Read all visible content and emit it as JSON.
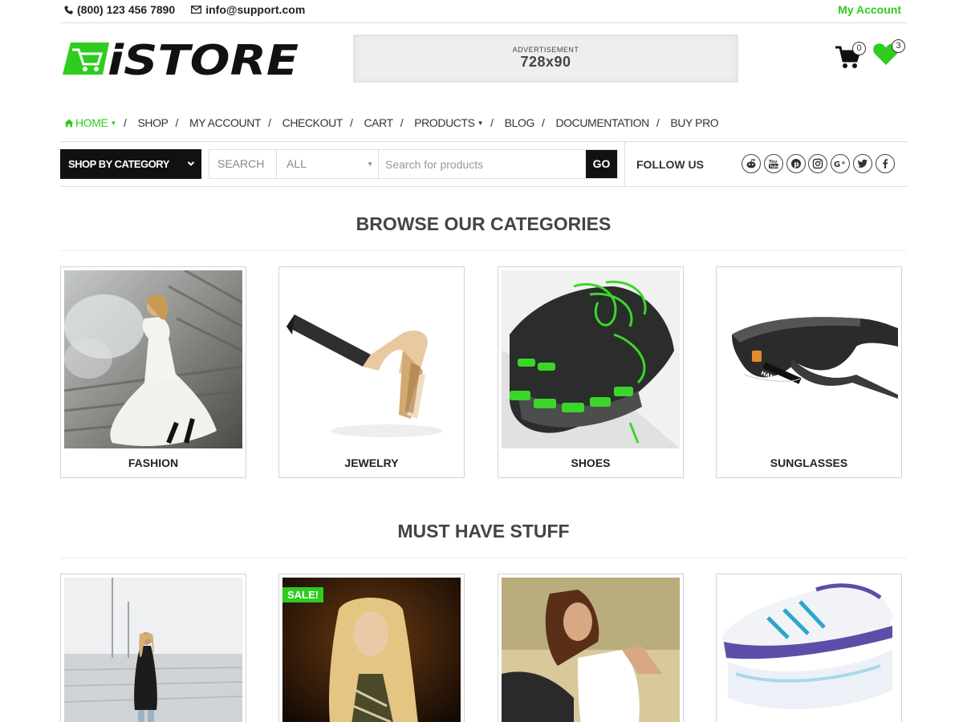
{
  "topbar": {
    "phone": "(800) 123 456 7890",
    "email": "info@support.com",
    "account_link": "My Account"
  },
  "header": {
    "logo_text": "iSTORE",
    "ad": {
      "label": "ADVERTISEMENT",
      "size": "728x90"
    },
    "cart_count": "0",
    "wishlist_count": "3"
  },
  "nav": {
    "items": [
      {
        "label": "HOME",
        "dropdown": true,
        "active": true
      },
      {
        "label": "SHOP"
      },
      {
        "label": "MY ACCOUNT"
      },
      {
        "label": "CHECKOUT"
      },
      {
        "label": "CART"
      },
      {
        "label": "PRODUCTS",
        "dropdown": true
      },
      {
        "label": "BLOG"
      },
      {
        "label": "DOCUMENTATION"
      },
      {
        "label": "BUY PRO"
      }
    ]
  },
  "search": {
    "shop_by_category": "SHOP BY CATEGORY",
    "label": "SEARCH",
    "category_selected": "ALL",
    "placeholder": "Search for products",
    "go": "GO"
  },
  "follow": {
    "label": "FOLLOW US",
    "icons": [
      "reddit-icon",
      "youtube-icon",
      "pinterest-icon",
      "instagram-icon",
      "google-plus-icon",
      "twitter-icon",
      "facebook-icon"
    ]
  },
  "categories": {
    "title": "BROWSE OUR CATEGORIES",
    "items": [
      {
        "label": "FASHION"
      },
      {
        "label": "JEWELRY"
      },
      {
        "label": "SHOES"
      },
      {
        "label": "SUNGLASSES"
      }
    ]
  },
  "must_have": {
    "title": "MUST HAVE STUFF",
    "sale_badge": "SALE!"
  },
  "colors": {
    "accent": "#2ecc1e",
    "dark": "#111111"
  }
}
